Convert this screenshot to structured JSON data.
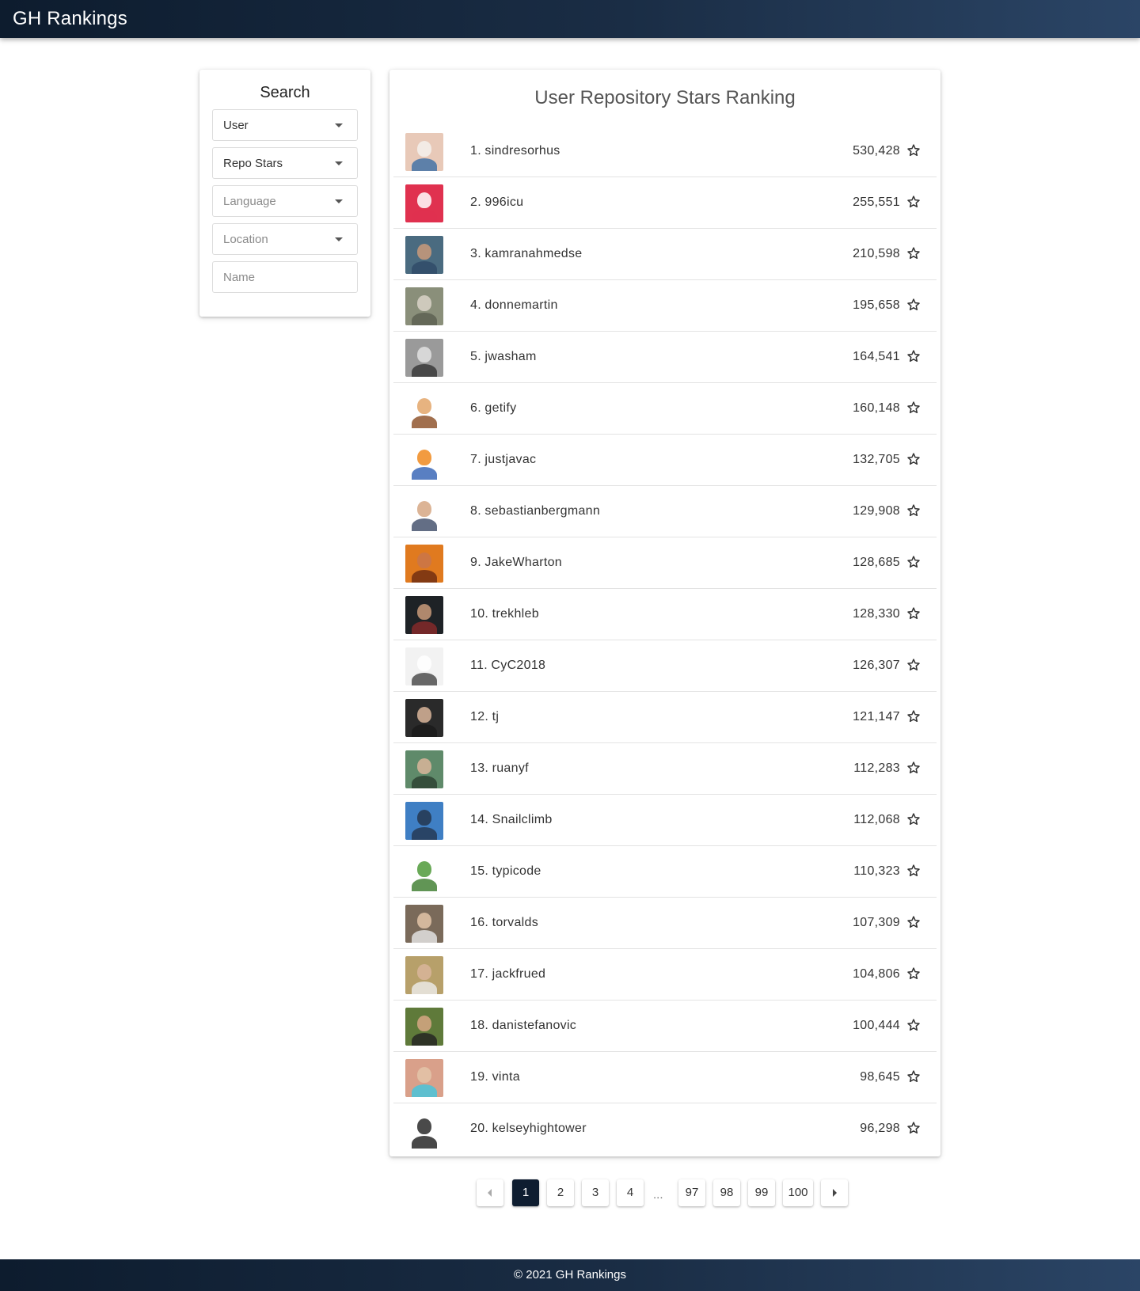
{
  "app": {
    "brand": "GH Rankings"
  },
  "search": {
    "title": "Search",
    "type_select": "User",
    "sort_select": "Repo Stars",
    "language_placeholder": "Language",
    "location_placeholder": "Location",
    "name_placeholder": "Name"
  },
  "ranking": {
    "title": "User Repository Stars Ranking",
    "rows": [
      {
        "rank": "1.",
        "name": "sindresorhus",
        "stars": "530,428",
        "avatar_bg": "#e8c9b8",
        "avatar_face": "#f5f1ec",
        "avatar_body": "#3a6ea5"
      },
      {
        "rank": "2.",
        "name": "996icu",
        "stars": "255,551",
        "avatar_bg": "#e0314f",
        "avatar_face": "#ffffff",
        "avatar_body": "#e0314f"
      },
      {
        "rank": "3.",
        "name": "kamranahmedse",
        "stars": "210,598",
        "avatar_bg": "#4a6b80",
        "avatar_face": "#c99a7a",
        "avatar_body": "#2e4a66"
      },
      {
        "rank": "4.",
        "name": "donnemartin",
        "stars": "195,658",
        "avatar_bg": "#8a8f7a",
        "avatar_face": "#d9d4c8",
        "avatar_body": "#5a5e50"
      },
      {
        "rank": "5.",
        "name": "jwasham",
        "stars": "164,541",
        "avatar_bg": "#9a9a9a",
        "avatar_face": "#e2e2e2",
        "avatar_body": "#333333"
      },
      {
        "rank": "6.",
        "name": "getify",
        "stars": "160,148",
        "avatar_bg": "#ffffff",
        "avatar_face": "#e3a66a",
        "avatar_body": "#8a4b22"
      },
      {
        "rank": "7.",
        "name": "justjavac",
        "stars": "132,705",
        "avatar_bg": "#ffffff",
        "avatar_face": "#f08a1e",
        "avatar_body": "#2f5fb3"
      },
      {
        "rank": "8.",
        "name": "sebastianbergmann",
        "stars": "129,908",
        "avatar_bg": "#ffffff",
        "avatar_face": "#d6a784",
        "avatar_body": "#3c4a66"
      },
      {
        "rank": "9.",
        "name": "JakeWharton",
        "stars": "128,685",
        "avatar_bg": "#e07a1f",
        "avatar_face": "#c9764a",
        "avatar_body": "#6b2a10"
      },
      {
        "rank": "10.",
        "name": "trekhleb",
        "stars": "128,330",
        "avatar_bg": "#1e2226",
        "avatar_face": "#c99a7a",
        "avatar_body": "#8a2a2a"
      },
      {
        "rank": "11.",
        "name": "CyC2018",
        "stars": "126,307",
        "avatar_bg": "#f2f2f2",
        "avatar_face": "#ffffff",
        "avatar_body": "#444444"
      },
      {
        "rank": "12.",
        "name": "tj",
        "stars": "121,147",
        "avatar_bg": "#2a2a2a",
        "avatar_face": "#d9b59a",
        "avatar_body": "#1a1a1a"
      },
      {
        "rank": "13.",
        "name": "ruanyf",
        "stars": "112,283",
        "avatar_bg": "#5f8a6a",
        "avatar_face": "#d9b59a",
        "avatar_body": "#2a3f30"
      },
      {
        "rank": "14.",
        "name": "Snailclimb",
        "stars": "112,068",
        "avatar_bg": "#3f7fc4",
        "avatar_face": "#24364f",
        "avatar_body": "#24364f"
      },
      {
        "rank": "15.",
        "name": "typicode",
        "stars": "110,323",
        "avatar_bg": "#ffffff",
        "avatar_face": "#4f9a3a",
        "avatar_body": "#3a7a2a"
      },
      {
        "rank": "16.",
        "name": "torvalds",
        "stars": "107,309",
        "avatar_bg": "#7a6a5a",
        "avatar_face": "#e3c4a8",
        "avatar_body": "#e8e8e8"
      },
      {
        "rank": "17.",
        "name": "jackfrued",
        "stars": "104,806",
        "avatar_bg": "#b7a06a",
        "avatar_face": "#d9b59a",
        "avatar_body": "#eeeeee"
      },
      {
        "rank": "18.",
        "name": "danistefanovic",
        "stars": "100,444",
        "avatar_bg": "#5f7a3a",
        "avatar_face": "#d6a784",
        "avatar_body": "#222222"
      },
      {
        "rank": "19.",
        "name": "vinta",
        "stars": "98,645",
        "avatar_bg": "#d9a08a",
        "avatar_face": "#e3c4a8",
        "avatar_body": "#3ec7e0"
      },
      {
        "rank": "20.",
        "name": "kelseyhightower",
        "stars": "96,298",
        "avatar_bg": "#ffffff",
        "avatar_face": "#2a2a2a",
        "avatar_body": "#1a1a1a"
      }
    ]
  },
  "pagination": {
    "prev_icon": "chevron-left-icon",
    "next_icon": "chevron-right-icon",
    "pages_start": [
      "1",
      "2",
      "3",
      "4"
    ],
    "ellipsis": "...",
    "pages_end": [
      "97",
      "98",
      "99",
      "100"
    ],
    "active_page": "1"
  },
  "footer": {
    "text": "© 2021 GH Rankings"
  },
  "colors": {
    "header_bg": "#0d1c2e",
    "active_page_bg": "#0e1d30"
  }
}
